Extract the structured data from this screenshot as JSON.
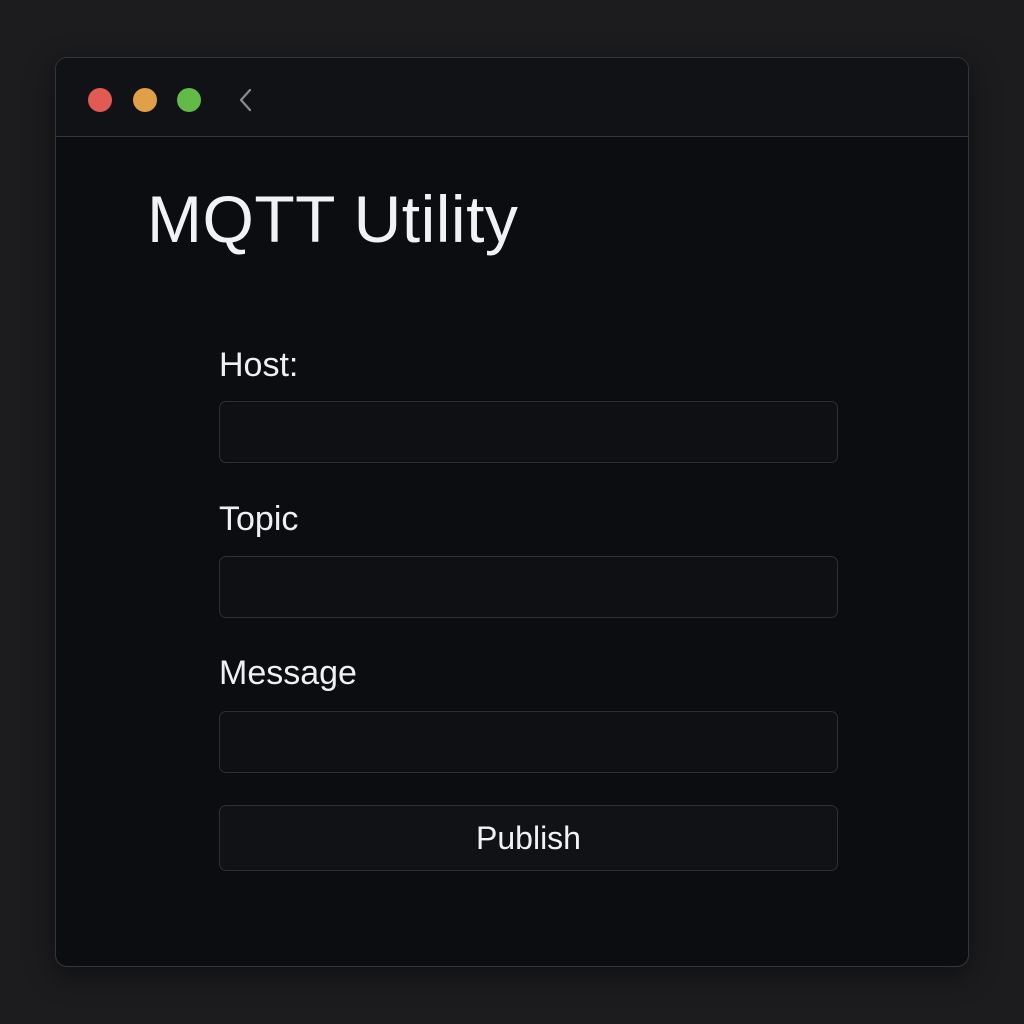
{
  "window": {
    "traffic_lights": {
      "close_color": "#e35a53",
      "minimize_color": "#e0a146",
      "maximize_color": "#61bb46"
    },
    "back_icon": "chevron-left-icon"
  },
  "app": {
    "title": "MQTT Utility"
  },
  "form": {
    "host": {
      "label": "Host:",
      "value": "",
      "placeholder": ""
    },
    "topic": {
      "label": "Topic",
      "value": "",
      "placeholder": ""
    },
    "message": {
      "label": "Message",
      "value": "",
      "placeholder": ""
    },
    "publish_label": "Publish"
  }
}
